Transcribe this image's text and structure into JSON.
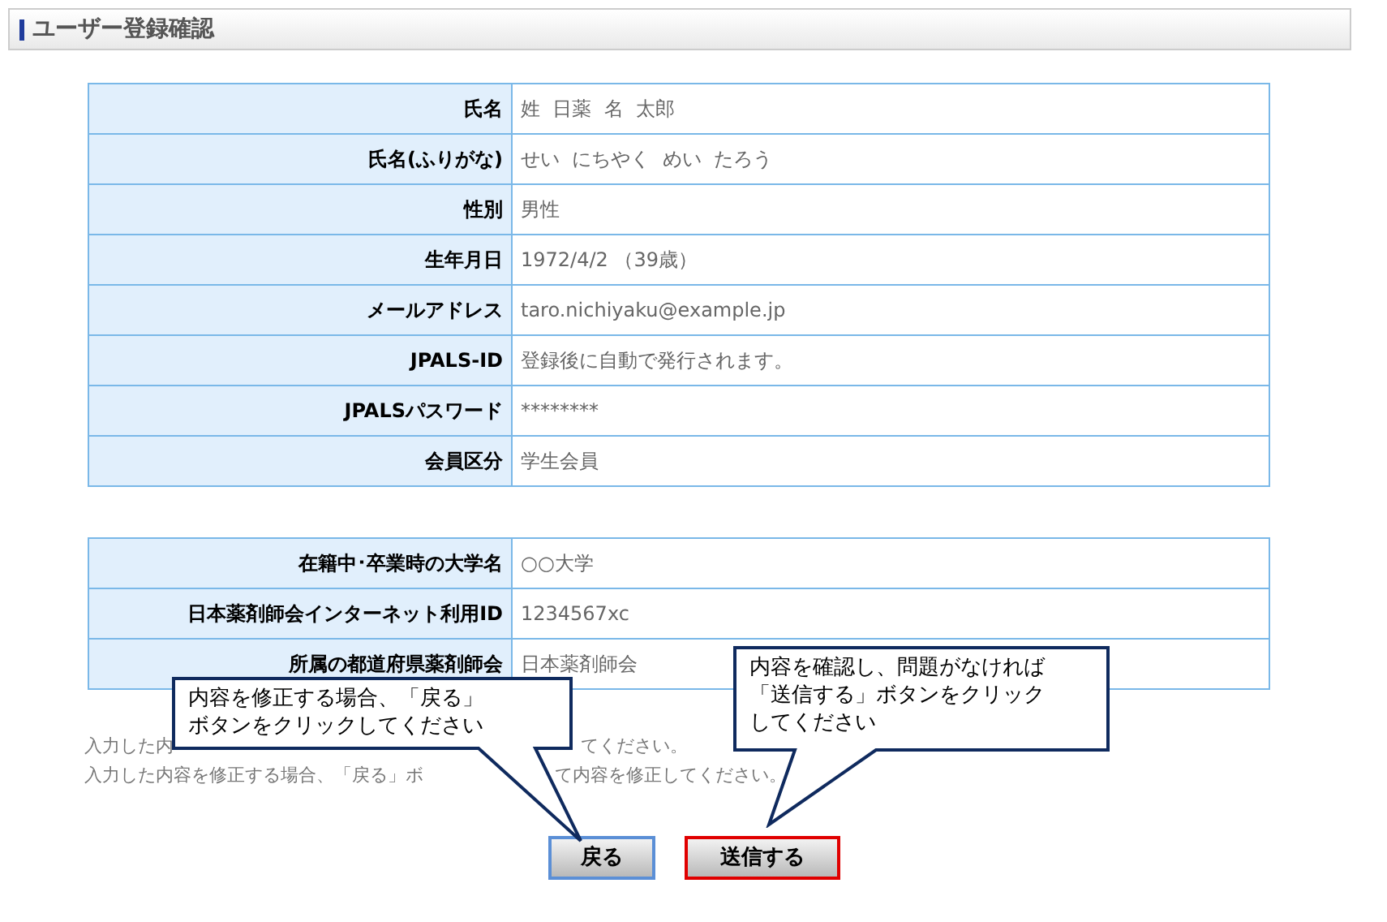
{
  "page_title": "ユーザー登録確認",
  "tables": [
    {
      "rows": [
        {
          "label": "氏名",
          "value": "姓  日薬  名  太郎"
        },
        {
          "label": "氏名(ふりがな)",
          "value": "せい  にちやく  めい  たろう"
        },
        {
          "label": "性別",
          "value": "男性"
        },
        {
          "label": "生年月日",
          "value": "1972/4/2 （39歳）"
        },
        {
          "label": "メールアドレス",
          "value": "taro.nichiyaku@example.jp"
        },
        {
          "label": "JPALS-ID",
          "value": "登録後に自動で発行されます。"
        },
        {
          "label": "JPALSパスワード",
          "value": "********"
        },
        {
          "label": "会員区分",
          "value": "学生会員"
        }
      ]
    },
    {
      "rows": [
        {
          "label": "在籍中･卒業時の大学名",
          "value": "○○大学"
        },
        {
          "label": "日本薬剤師会インターネット利用ID",
          "value": "1234567xc"
        },
        {
          "label": "所属の都道府県薬剤師会",
          "value": "日本薬剤師会"
        }
      ]
    }
  ],
  "notes": [
    {
      "parts": [
        "入力した内",
        "てください。"
      ]
    },
    {
      "parts": [
        "入力した内容を修正する場合、「戻る」ボ",
        "て内容を修正してください。"
      ]
    }
  ],
  "callouts": [
    {
      "text": "内容を修正する場合、「戻る」ボタンをクリックしてください"
    },
    {
      "text": "内容を確認し、問題がなければ「送信する」ボタンをクリックしてください"
    }
  ],
  "buttons": [
    {
      "label": "戻る",
      "kind": "back"
    },
    {
      "label": "送信する",
      "kind": "submit"
    }
  ]
}
